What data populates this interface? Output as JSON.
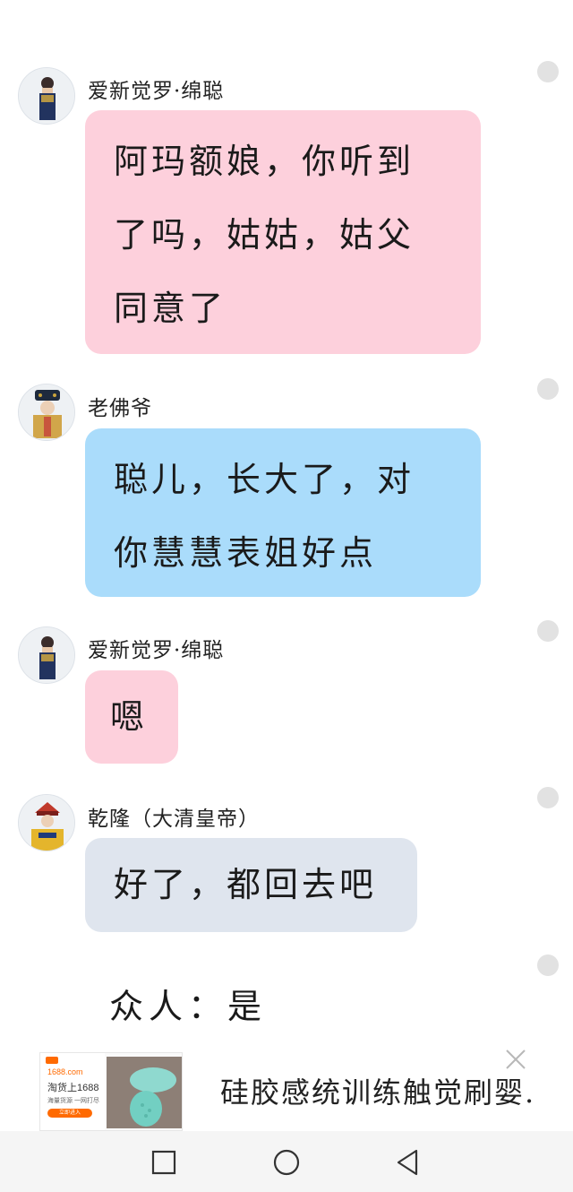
{
  "messages": [
    {
      "sender": "爱新觉罗·绵聪",
      "text_lines": [
        "阿玛额娘，你听到",
        "了吗，姑姑，姑父",
        "同意了"
      ],
      "color": "#fdd0dc"
    },
    {
      "sender": "老佛爷",
      "text_lines": [
        "聪儿，长大了，对",
        "你慧慧表姐好点"
      ],
      "color": "#aadcfb"
    },
    {
      "sender": "爱新觉罗·绵聪",
      "text_lines": [
        "嗯"
      ],
      "color": "#fdd0dc"
    },
    {
      "sender": "乾隆（大清皇帝）",
      "text_lines": [
        "好了，都回去吧"
      ],
      "color": "#dfe5ee"
    }
  ],
  "narration": "众人：是",
  "ad": {
    "thumb_site": "1688.com",
    "thumb_title": "淘货上1688",
    "thumb_sub": "海量货源 一网打尽",
    "thumb_button": "立即进入",
    "text": "硅胶感统训练触觉刷婴.",
    "close_icon": "close-icon"
  },
  "navbar": {
    "icons": [
      "recent-apps-icon",
      "home-icon",
      "back-icon"
    ]
  }
}
